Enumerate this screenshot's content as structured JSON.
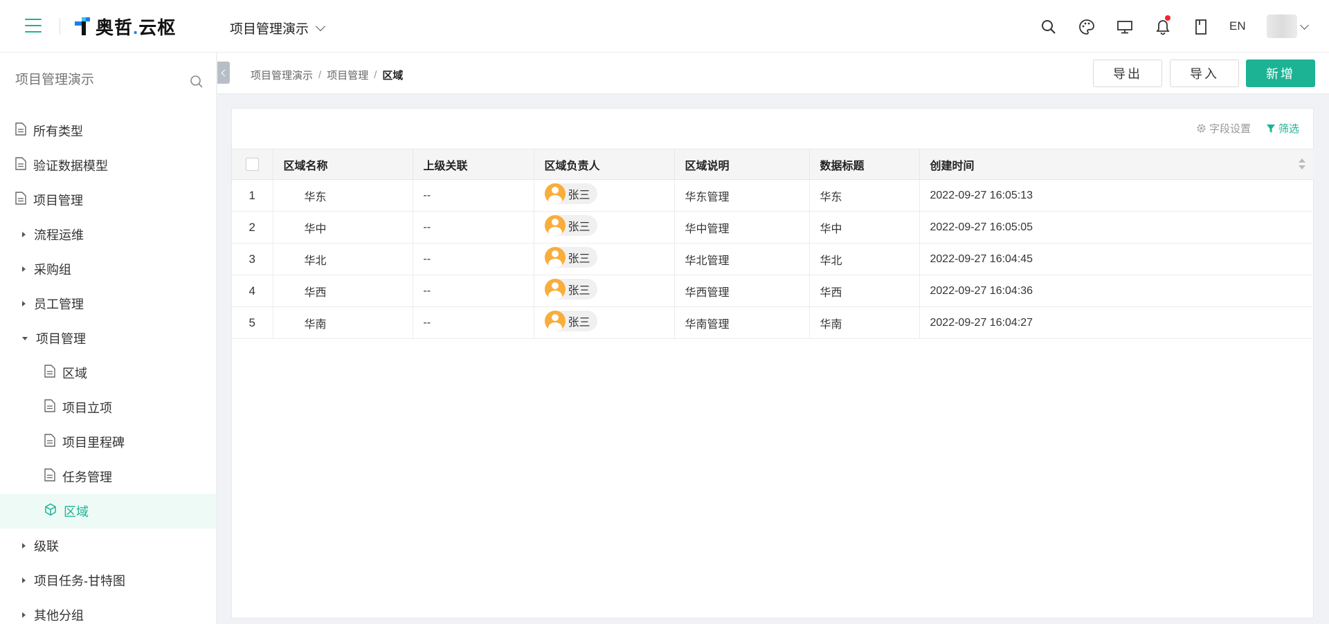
{
  "header": {
    "logo_text": "奥哲",
    "logo_dot": ".",
    "logo_text2": "云枢",
    "project_name": "项目管理演示",
    "lang": "EN",
    "accent_color": "#1bb394"
  },
  "sidebar": {
    "search_placeholder": "项目管理演示",
    "items": [
      {
        "label": "所有类型",
        "icon": "document-icon"
      },
      {
        "label": "验证数据模型",
        "icon": "document-icon"
      },
      {
        "label": "项目管理",
        "icon": "document-icon"
      },
      {
        "label": "流程运维",
        "icon": "caret-right-icon"
      },
      {
        "label": "采购组",
        "icon": "caret-right-icon"
      },
      {
        "label": "员工管理",
        "icon": "caret-right-icon"
      },
      {
        "label": "项目管理",
        "icon": "caret-down-icon"
      },
      {
        "label": "区域",
        "icon": "document-icon"
      },
      {
        "label": "项目立项",
        "icon": "document-icon"
      },
      {
        "label": "项目里程碑",
        "icon": "document-icon"
      },
      {
        "label": "任务管理",
        "icon": "document-icon"
      },
      {
        "label": "区域",
        "icon": "cube-icon",
        "active": true
      },
      {
        "label": "级联",
        "icon": "caret-right-icon"
      },
      {
        "label": "项目任务-甘特图",
        "icon": "caret-right-icon"
      },
      {
        "label": "其他分组",
        "icon": "caret-right-icon"
      }
    ]
  },
  "breadcrumb": [
    "项目管理演示",
    "项目管理",
    "区域"
  ],
  "breadcrumb_sep": "/",
  "actions": {
    "export": "导出",
    "import": "导入",
    "add": "新增"
  },
  "tools": {
    "field_settings": "字段设置",
    "filter": "筛选"
  },
  "table": {
    "columns": [
      "区域名称",
      "上级关联",
      "区域负责人",
      "区域说明",
      "数据标题",
      "创建时间"
    ],
    "rows": [
      {
        "idx": "1",
        "name": "华东",
        "parent": "--",
        "owner": "张三",
        "desc": "华东管理",
        "title": "华东",
        "created": "2022-09-27 16:05:13"
      },
      {
        "idx": "2",
        "name": "华中",
        "parent": "--",
        "owner": "张三",
        "desc": "华中管理",
        "title": "华中",
        "created": "2022-09-27 16:05:05"
      },
      {
        "idx": "3",
        "name": "华北",
        "parent": "--",
        "owner": "张三",
        "desc": "华北管理",
        "title": "华北",
        "created": "2022-09-27 16:04:45"
      },
      {
        "idx": "4",
        "name": "华西",
        "parent": "--",
        "owner": "张三",
        "desc": "华西管理",
        "title": "华西",
        "created": "2022-09-27 16:04:36"
      },
      {
        "idx": "5",
        "name": "华南",
        "parent": "--",
        "owner": "张三",
        "desc": "华南管理",
        "title": "华南",
        "created": "2022-09-27 16:04:27"
      }
    ]
  }
}
